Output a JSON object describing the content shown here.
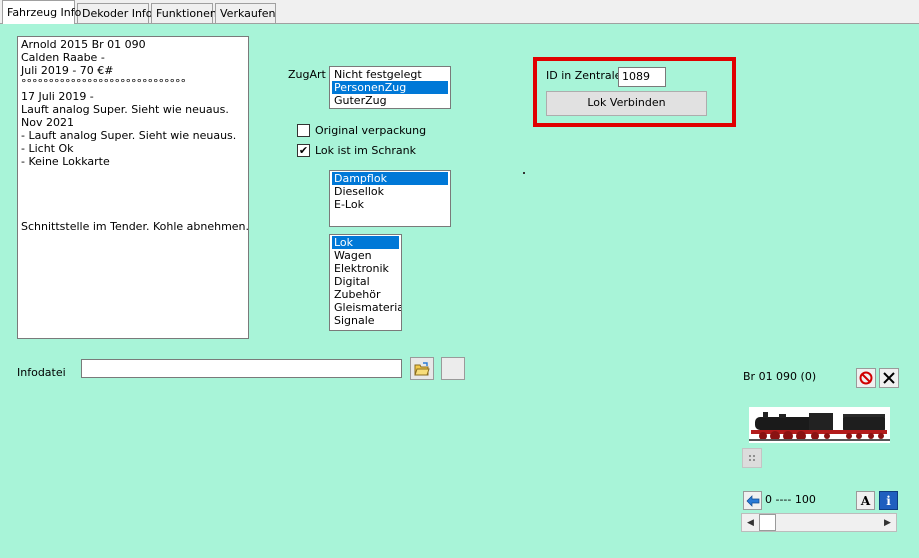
{
  "tabs": [
    {
      "label": "Fahrzeug Info",
      "active": true
    },
    {
      "label": "Dekoder Info",
      "active": false
    },
    {
      "label": "Funktionen",
      "active": false
    },
    {
      "label": "Verkaufen",
      "active": false
    }
  ],
  "notes": {
    "text": "Arnold 2015 Br 01 090\nCalden Raabe -\nJuli 2019 - 70 €#\n°°°°°°°°°°°°°°°°°°°°°°°°°°°°°°\n17 Juli 2019 -\nLauft analog Super. Sieht wie neuaus.\nNov 2021\n- Lauft analog Super. Sieht wie neuaus.\n- Licht Ok\n- Keine Lokkarte\n\n\n\n\nSchnittstelle im Tender. Kohle abnehmen."
  },
  "zugart": {
    "label": "ZugArt",
    "options": [
      "Nicht festgelegt",
      "PersonenZug",
      "GuterZug"
    ],
    "selected_index": 1
  },
  "checkboxes": {
    "original_verpackung": {
      "label": "Original verpackung",
      "checked": false,
      "mark": ""
    },
    "lok_im_schrank": {
      "label": "Lok ist im Schrank",
      "checked": true,
      "mark": "✔"
    }
  },
  "loktyp": {
    "options": [
      "Dampflok",
      "Diesellok",
      "E-Lok"
    ],
    "selected_index": 0
  },
  "kategorie": {
    "options": [
      "Lok",
      "Wagen",
      "Elektronik",
      "Digital",
      "Zubehör",
      "Gleismaterial",
      "Signale"
    ],
    "selected_index": 0
  },
  "zentrale": {
    "id_label": "ID in Zentrale",
    "id_value": "1089",
    "connect_button": "Lok Verbinden"
  },
  "infodatei": {
    "label": "Infodatei",
    "value": ""
  },
  "loco_card": {
    "title": "Br 01 090 (0)",
    "speed_range": "0 ---- 100",
    "font_button": "A",
    "info_button": "i"
  },
  "colors": {
    "panel_bg": "#a8f4d8",
    "selection": "#0078d7",
    "highlight_box": "#e00000"
  }
}
